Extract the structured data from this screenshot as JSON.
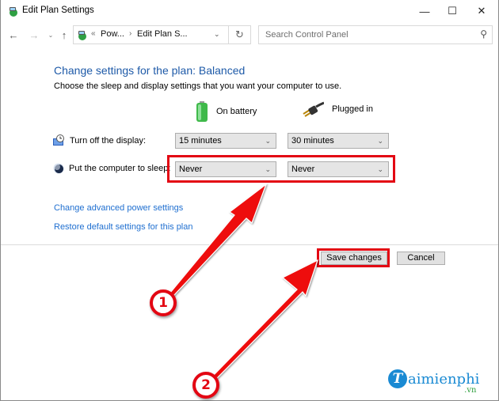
{
  "window": {
    "title": "Edit Plan Settings",
    "controls": {
      "minimize": "—",
      "maximize": "☐",
      "close": "✕"
    }
  },
  "navbar": {
    "back": "←",
    "forward": "→",
    "recent": "⌄",
    "up": "↑",
    "address": {
      "overflow": "«",
      "crumbs": [
        "Pow...",
        "Edit Plan S..."
      ],
      "separator": "›",
      "dropdown": "⌄"
    },
    "refresh": "↻",
    "search": {
      "placeholder": "Search Control Panel",
      "icon": "⚲"
    }
  },
  "main": {
    "heading": "Change settings for the plan: Balanced",
    "subheading": "Choose the sleep and display settings that you want your computer to use.",
    "columns": [
      {
        "label": "On battery",
        "icon": "battery-icon"
      },
      {
        "label": "Plugged in",
        "icon": "power-plug-icon"
      }
    ],
    "rows": [
      {
        "label": "Turn off the display:",
        "icon": "display-clock-icon",
        "on_battery": "15 minutes",
        "plugged_in": "30 minutes"
      },
      {
        "label": "Put the computer to sleep:",
        "icon": "sleep-moon-icon",
        "on_battery": "Never",
        "plugged_in": "Never"
      }
    ],
    "links": [
      "Change advanced power settings",
      "Restore default settings for this plan"
    ]
  },
  "footer": {
    "save_label": "Save changes",
    "cancel_label": "Cancel"
  },
  "annotations": {
    "step1": "1",
    "step2": "2",
    "highlight_color": "#e30613"
  },
  "watermark": {
    "letter": "T",
    "text": "aimienphi",
    "suffix": ".vn"
  },
  "colors": {
    "heading": "#1e5aa8",
    "link": "#1f6fd0",
    "annotation_red": "#e30613",
    "logo_blue": "#1a8ad3",
    "logo_green": "#2a9d3a"
  }
}
